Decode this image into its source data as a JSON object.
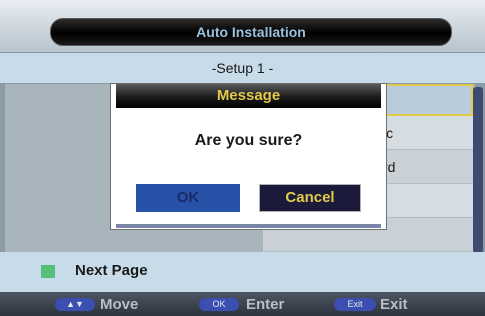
{
  "window": {
    "title": "Auto Installation",
    "subtitle": "-Setup 1 -"
  },
  "list": {
    "rows": [
      {
        "text": ""
      },
      {
        "text": "ic"
      },
      {
        "text": "rd"
      },
      {
        "text": ""
      },
      {
        "text": ""
      }
    ]
  },
  "dialog": {
    "header": "Message",
    "message": "Are you sure?",
    "ok_label": "OK",
    "cancel_label": "Cancel"
  },
  "footer": {
    "next_page_label": "Next Page",
    "help": [
      {
        "key": "▲▼",
        "label": "Move"
      },
      {
        "key": "OK",
        "label": "Enter"
      },
      {
        "key": "Exit",
        "label": "Exit"
      }
    ]
  },
  "colors": {
    "accent": "#e3c94a",
    "ok_button": "#2851a8",
    "green_key": "#55c07a"
  }
}
